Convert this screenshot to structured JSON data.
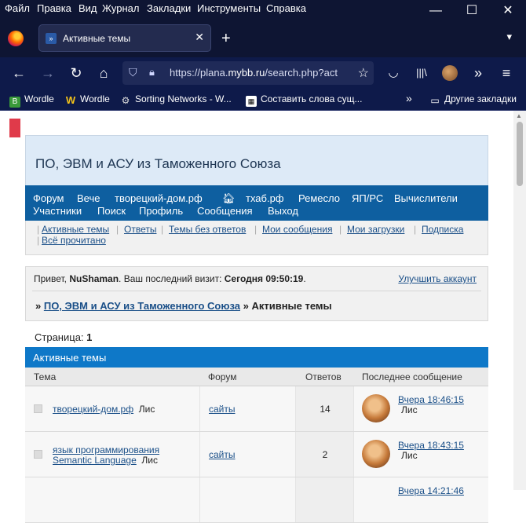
{
  "menu": [
    "Файл",
    "Правка",
    "Вид",
    "Журнал",
    "Закладки",
    "Инструменты",
    "Справка"
  ],
  "window_controls": {
    "minimize": "—",
    "maximize": "☐",
    "close": "✕"
  },
  "tab": {
    "title": "Активные темы"
  },
  "address": {
    "url_prefix": "https://plana.",
    "url_host": "mybb.ru",
    "url_rest": "/search.php?act"
  },
  "bookmarks": [
    {
      "label": "Wordle",
      "icon": "wordle-b-icon"
    },
    {
      "label": "Wordle",
      "icon": "wordle-w-icon"
    },
    {
      "label": "Sorting Networks - W...",
      "icon": "gear-icon"
    },
    {
      "label": "Составить слова сущ...",
      "icon": "grid-icon"
    }
  ],
  "bookmarks_other": "Другие закладки",
  "forum": {
    "title": "ПО, ЭВМ и АСУ из Таможенного Союза",
    "nav_row1": [
      "Форум",
      "Вече",
      "творецкий-дом.рф",
      "тхаб.рф",
      "Ремесло",
      "ЯП/РС",
      "Вычислители"
    ],
    "nav_row2": [
      "Участники",
      "Поиск",
      "Профиль",
      "Сообщения",
      "Выход"
    ],
    "subnav_row1": [
      "Активные темы",
      "Ответы",
      "Темы без ответов",
      "Мои сообщения",
      "Мои загрузки",
      "Подписка"
    ],
    "subnav_row2": [
      "Всё прочитано"
    ]
  },
  "welcome": {
    "greeting": "Привет, ",
    "user": "NuShaman",
    "last_visit_label": ".  Ваш последний визит: ",
    "last_visit": "Сегодня 09:50:19",
    "dot": ".",
    "upgrade": "Улучшить аккаунт",
    "crumb_prefix": "» ",
    "crumb_forum": "ПО, ЭВМ и АСУ из Таможенного Союза",
    "crumb_sep": " » ",
    "crumb_current": "Активные темы"
  },
  "pages": {
    "label": "Страница: ",
    "current": "1"
  },
  "table": {
    "caption": "Активные темы",
    "headers": [
      "Тема",
      "Форум",
      "Ответов",
      "Последнее сообщение"
    ],
    "rows": [
      {
        "topic": "творецкий-дом.рф",
        "topic2": "",
        "author": "Лис",
        "forum": "сайты",
        "replies": "14",
        "last_time": "Вчера 18:46:15",
        "last_author": "Лис"
      },
      {
        "topic": "язык программирования",
        "topic2": "Semantic Language",
        "author": "Лис",
        "forum": "сайты",
        "replies": "2",
        "last_time": "Вчера 18:43:15",
        "last_author": "Лис"
      },
      {
        "topic": "",
        "topic2": "",
        "author": "",
        "forum": "",
        "replies": "",
        "last_time": "Вчера 14:21:46",
        "last_author": ""
      }
    ]
  }
}
